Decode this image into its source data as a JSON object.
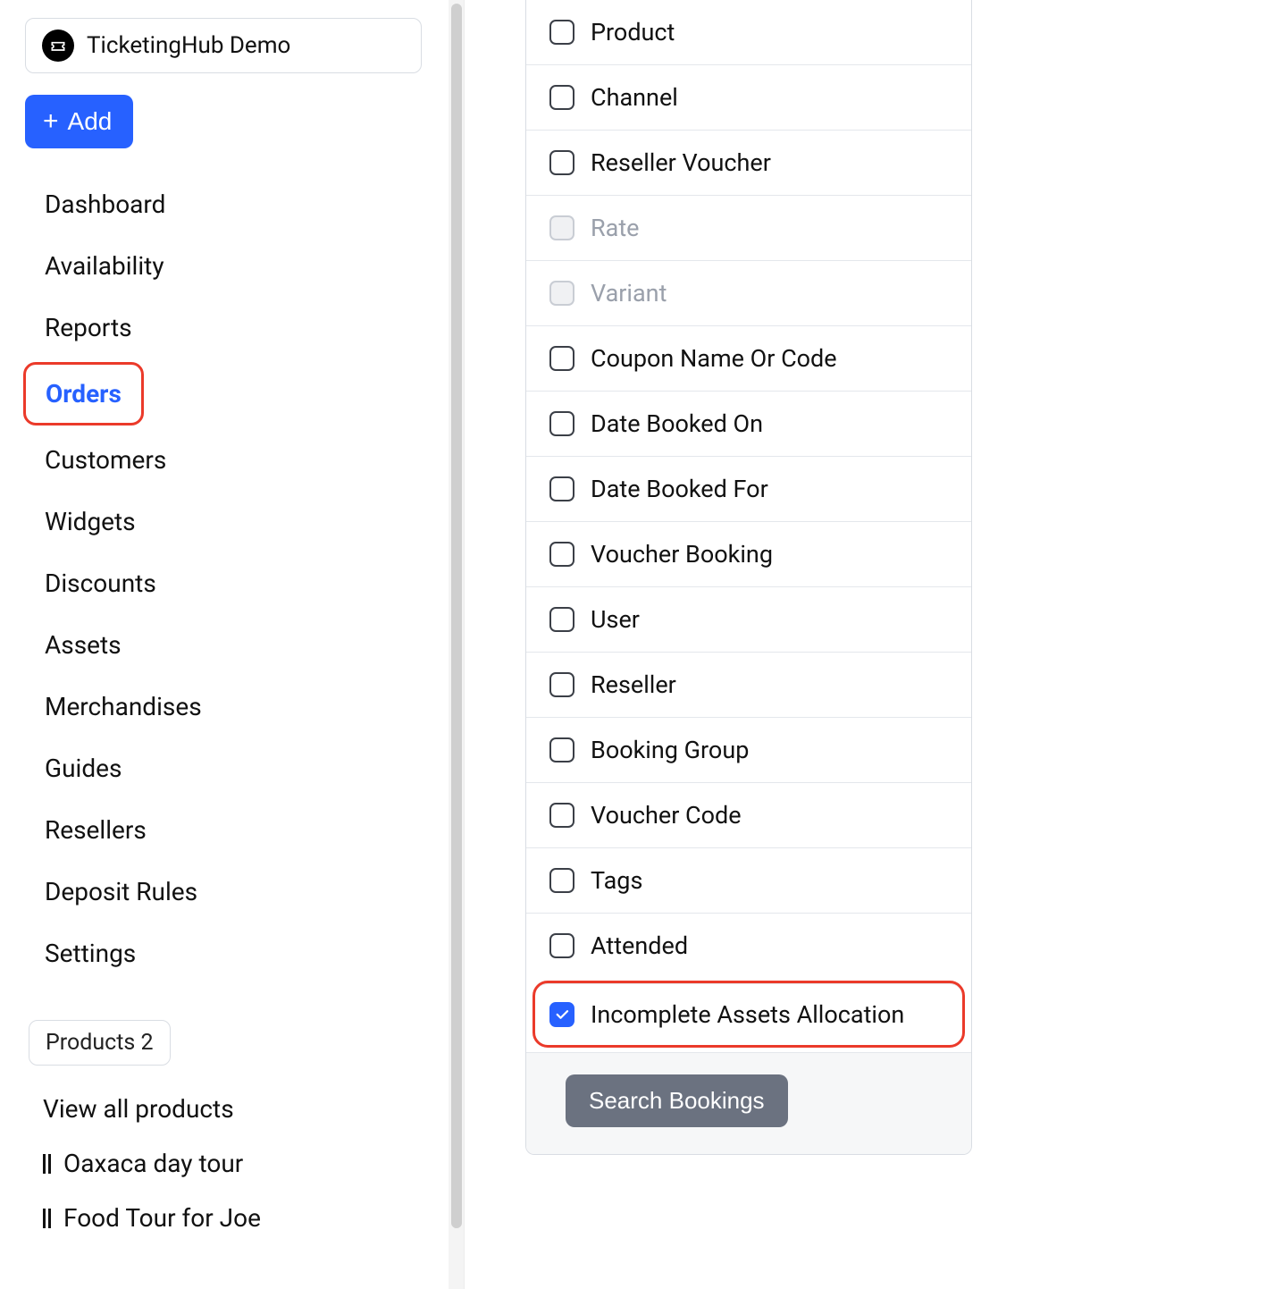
{
  "brand": {
    "name": "TicketingHub Demo"
  },
  "add_button": {
    "label": "Add"
  },
  "nav": {
    "items": [
      {
        "id": "dashboard",
        "label": "Dashboard",
        "active": false
      },
      {
        "id": "availability",
        "label": "Availability",
        "active": false
      },
      {
        "id": "reports",
        "label": "Reports",
        "active": false
      },
      {
        "id": "orders",
        "label": "Orders",
        "active": true
      },
      {
        "id": "customers",
        "label": "Customers",
        "active": false
      },
      {
        "id": "widgets",
        "label": "Widgets",
        "active": false
      },
      {
        "id": "discounts",
        "label": "Discounts",
        "active": false
      },
      {
        "id": "assets",
        "label": "Assets",
        "active": false
      },
      {
        "id": "merchandises",
        "label": "Merchandises",
        "active": false
      },
      {
        "id": "guides",
        "label": "Guides",
        "active": false
      },
      {
        "id": "resellers",
        "label": "Resellers",
        "active": false
      },
      {
        "id": "deposit-rules",
        "label": "Deposit Rules",
        "active": false
      },
      {
        "id": "settings",
        "label": "Settings",
        "active": false
      }
    ]
  },
  "products_section": {
    "pill": "Products 2",
    "view_all": "View all products",
    "items": [
      {
        "label": "Oaxaca day tour"
      },
      {
        "label": "Food Tour for Joe"
      }
    ]
  },
  "filters": {
    "items": [
      {
        "id": "product",
        "label": "Product",
        "checked": false,
        "disabled": false
      },
      {
        "id": "channel",
        "label": "Channel",
        "checked": false,
        "disabled": false
      },
      {
        "id": "reseller-voucher",
        "label": "Reseller Voucher",
        "checked": false,
        "disabled": false
      },
      {
        "id": "rate",
        "label": "Rate",
        "checked": false,
        "disabled": true
      },
      {
        "id": "variant",
        "label": "Variant",
        "checked": false,
        "disabled": true
      },
      {
        "id": "coupon",
        "label": "Coupon Name Or Code",
        "checked": false,
        "disabled": false
      },
      {
        "id": "date-booked-on",
        "label": "Date Booked On",
        "checked": false,
        "disabled": false
      },
      {
        "id": "date-booked-for",
        "label": "Date Booked For",
        "checked": false,
        "disabled": false
      },
      {
        "id": "voucher-booking",
        "label": "Voucher Booking",
        "checked": false,
        "disabled": false
      },
      {
        "id": "user",
        "label": "User",
        "checked": false,
        "disabled": false
      },
      {
        "id": "reseller",
        "label": "Reseller",
        "checked": false,
        "disabled": false
      },
      {
        "id": "booking-group",
        "label": "Booking Group",
        "checked": false,
        "disabled": false
      },
      {
        "id": "voucher-code",
        "label": "Voucher Code",
        "checked": false,
        "disabled": false
      },
      {
        "id": "tags",
        "label": "Tags",
        "checked": false,
        "disabled": false
      },
      {
        "id": "attended",
        "label": "Attended",
        "checked": false,
        "disabled": false
      },
      {
        "id": "incomplete-assets",
        "label": "Incomplete Assets Allocation",
        "checked": true,
        "disabled": false,
        "highlight": true
      }
    ],
    "search_button": "Search Bookings"
  }
}
